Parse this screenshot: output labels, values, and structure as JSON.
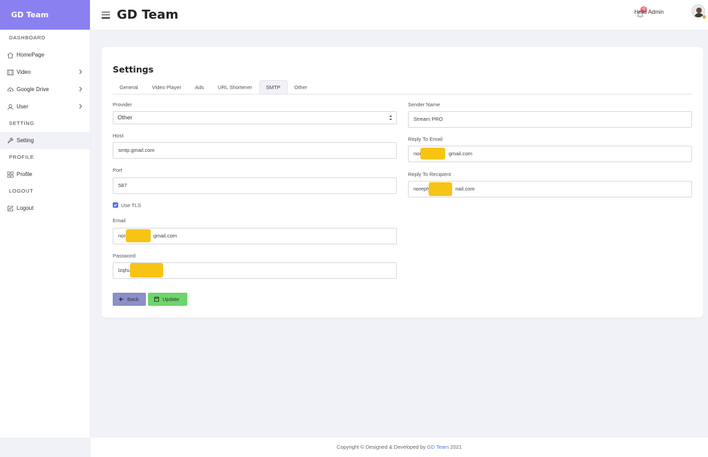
{
  "sidebar": {
    "brand": "GD Team",
    "sections": {
      "dashboard": "DASHBOARD",
      "setting": "SETTING",
      "profile": "PROFILE",
      "logout": "LOGOUT"
    },
    "items": {
      "homepage": "HomePage",
      "video": "Video",
      "google_drive": "Google Drive",
      "user": "User",
      "setting": "Setting",
      "profile": "Profile",
      "logout": "Logout"
    }
  },
  "header": {
    "title": "GD Team",
    "notification_count": "1",
    "greeting": "Hello Admin"
  },
  "settings": {
    "title": "Settings",
    "tabs": [
      "General",
      "Video Player",
      "Ads",
      "URL Shortener",
      "SMTP",
      "Other"
    ],
    "active_tab": "SMTP",
    "fields": {
      "provider_label": "Provider",
      "provider_value": "Other",
      "host_label": "Host",
      "host_value": "smtp.gmail.com",
      "port_label": "Port",
      "port_value": "587",
      "use_tls_label": "Use TLS",
      "email_label": "Email",
      "email_value_prefix": "nor",
      "email_value_suffix": "gmail.com",
      "password_label": "Password",
      "password_value_prefix": "lzqhu",
      "sender_name_label": "Sender Name",
      "sender_name_value": "Stream PRO",
      "reply_to_email_label": "Reply To Email",
      "reply_to_email_prefix": "nor",
      "reply_to_email_suffix": "gmail.com",
      "reply_to_recipient_label": "Reply To Recipient",
      "reply_to_recipient_prefix": "noreply",
      "reply_to_recipient_suffix": "nail.com"
    },
    "buttons": {
      "back": "Back",
      "update": "Update"
    }
  },
  "footer": {
    "text": "Copyright © Designed & Developed by",
    "brand": "GD Team",
    "year": "2021"
  },
  "colors": {
    "brand": "#8b80f0",
    "accent": "#5b73e8",
    "update_button": "#6dd56b",
    "back_button": "#8c8fc8",
    "badge": "#f27a8c"
  }
}
